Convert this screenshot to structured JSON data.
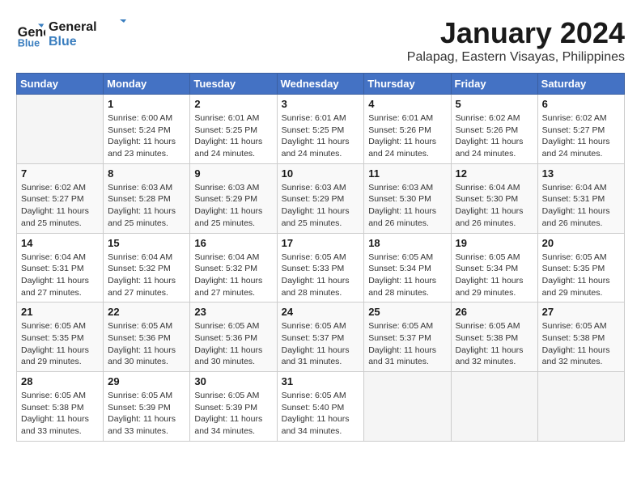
{
  "logo": {
    "line1": "General",
    "line2": "Blue"
  },
  "title": "January 2024",
  "subtitle": "Palapag, Eastern Visayas, Philippines",
  "days_of_week": [
    "Sunday",
    "Monday",
    "Tuesday",
    "Wednesday",
    "Thursday",
    "Friday",
    "Saturday"
  ],
  "weeks": [
    [
      {
        "day": "",
        "info": ""
      },
      {
        "day": "1",
        "info": "Sunrise: 6:00 AM\nSunset: 5:24 PM\nDaylight: 11 hours\nand 23 minutes."
      },
      {
        "day": "2",
        "info": "Sunrise: 6:01 AM\nSunset: 5:25 PM\nDaylight: 11 hours\nand 24 minutes."
      },
      {
        "day": "3",
        "info": "Sunrise: 6:01 AM\nSunset: 5:25 PM\nDaylight: 11 hours\nand 24 minutes."
      },
      {
        "day": "4",
        "info": "Sunrise: 6:01 AM\nSunset: 5:26 PM\nDaylight: 11 hours\nand 24 minutes."
      },
      {
        "day": "5",
        "info": "Sunrise: 6:02 AM\nSunset: 5:26 PM\nDaylight: 11 hours\nand 24 minutes."
      },
      {
        "day": "6",
        "info": "Sunrise: 6:02 AM\nSunset: 5:27 PM\nDaylight: 11 hours\nand 24 minutes."
      }
    ],
    [
      {
        "day": "7",
        "info": "Sunrise: 6:02 AM\nSunset: 5:27 PM\nDaylight: 11 hours\nand 25 minutes."
      },
      {
        "day": "8",
        "info": "Sunrise: 6:03 AM\nSunset: 5:28 PM\nDaylight: 11 hours\nand 25 minutes."
      },
      {
        "day": "9",
        "info": "Sunrise: 6:03 AM\nSunset: 5:29 PM\nDaylight: 11 hours\nand 25 minutes."
      },
      {
        "day": "10",
        "info": "Sunrise: 6:03 AM\nSunset: 5:29 PM\nDaylight: 11 hours\nand 25 minutes."
      },
      {
        "day": "11",
        "info": "Sunrise: 6:03 AM\nSunset: 5:30 PM\nDaylight: 11 hours\nand 26 minutes."
      },
      {
        "day": "12",
        "info": "Sunrise: 6:04 AM\nSunset: 5:30 PM\nDaylight: 11 hours\nand 26 minutes."
      },
      {
        "day": "13",
        "info": "Sunrise: 6:04 AM\nSunset: 5:31 PM\nDaylight: 11 hours\nand 26 minutes."
      }
    ],
    [
      {
        "day": "14",
        "info": "Sunrise: 6:04 AM\nSunset: 5:31 PM\nDaylight: 11 hours\nand 27 minutes."
      },
      {
        "day": "15",
        "info": "Sunrise: 6:04 AM\nSunset: 5:32 PM\nDaylight: 11 hours\nand 27 minutes."
      },
      {
        "day": "16",
        "info": "Sunrise: 6:04 AM\nSunset: 5:32 PM\nDaylight: 11 hours\nand 27 minutes."
      },
      {
        "day": "17",
        "info": "Sunrise: 6:05 AM\nSunset: 5:33 PM\nDaylight: 11 hours\nand 28 minutes."
      },
      {
        "day": "18",
        "info": "Sunrise: 6:05 AM\nSunset: 5:34 PM\nDaylight: 11 hours\nand 28 minutes."
      },
      {
        "day": "19",
        "info": "Sunrise: 6:05 AM\nSunset: 5:34 PM\nDaylight: 11 hours\nand 29 minutes."
      },
      {
        "day": "20",
        "info": "Sunrise: 6:05 AM\nSunset: 5:35 PM\nDaylight: 11 hours\nand 29 minutes."
      }
    ],
    [
      {
        "day": "21",
        "info": "Sunrise: 6:05 AM\nSunset: 5:35 PM\nDaylight: 11 hours\nand 29 minutes."
      },
      {
        "day": "22",
        "info": "Sunrise: 6:05 AM\nSunset: 5:36 PM\nDaylight: 11 hours\nand 30 minutes."
      },
      {
        "day": "23",
        "info": "Sunrise: 6:05 AM\nSunset: 5:36 PM\nDaylight: 11 hours\nand 30 minutes."
      },
      {
        "day": "24",
        "info": "Sunrise: 6:05 AM\nSunset: 5:37 PM\nDaylight: 11 hours\nand 31 minutes."
      },
      {
        "day": "25",
        "info": "Sunrise: 6:05 AM\nSunset: 5:37 PM\nDaylight: 11 hours\nand 31 minutes."
      },
      {
        "day": "26",
        "info": "Sunrise: 6:05 AM\nSunset: 5:38 PM\nDaylight: 11 hours\nand 32 minutes."
      },
      {
        "day": "27",
        "info": "Sunrise: 6:05 AM\nSunset: 5:38 PM\nDaylight: 11 hours\nand 32 minutes."
      }
    ],
    [
      {
        "day": "28",
        "info": "Sunrise: 6:05 AM\nSunset: 5:38 PM\nDaylight: 11 hours\nand 33 minutes."
      },
      {
        "day": "29",
        "info": "Sunrise: 6:05 AM\nSunset: 5:39 PM\nDaylight: 11 hours\nand 33 minutes."
      },
      {
        "day": "30",
        "info": "Sunrise: 6:05 AM\nSunset: 5:39 PM\nDaylight: 11 hours\nand 34 minutes."
      },
      {
        "day": "31",
        "info": "Sunrise: 6:05 AM\nSunset: 5:40 PM\nDaylight: 11 hours\nand 34 minutes."
      },
      {
        "day": "",
        "info": ""
      },
      {
        "day": "",
        "info": ""
      },
      {
        "day": "",
        "info": ""
      }
    ]
  ]
}
